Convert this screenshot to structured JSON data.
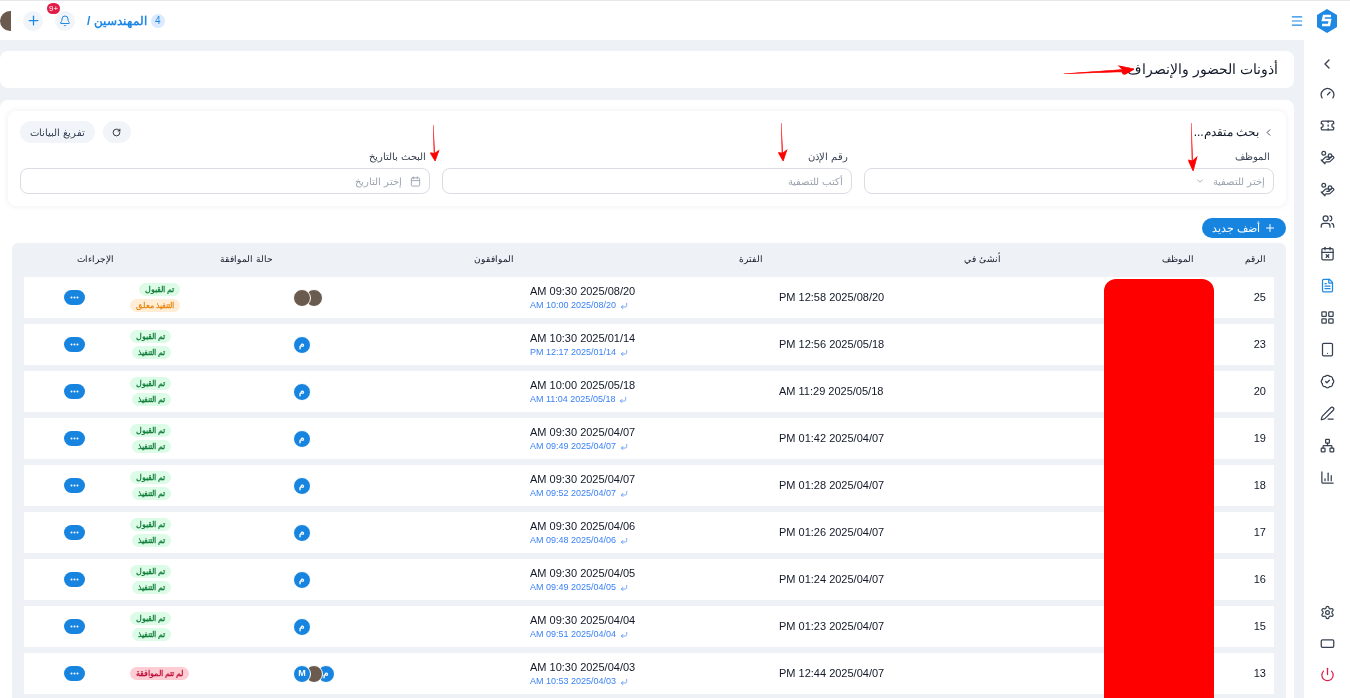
{
  "topbar": {
    "breadcrumb": "المهندسين /",
    "breadcrumb_count": "4",
    "notification_badge": "+9"
  },
  "sidebar": {
    "items": [
      {
        "selected": false
      },
      {
        "selected": false
      },
      {
        "selected": false
      },
      {
        "selected": false
      },
      {
        "selected": false
      },
      {
        "selected": false
      },
      {
        "selected": true
      },
      {
        "selected": false
      },
      {
        "selected": false
      },
      {
        "selected": false
      },
      {
        "selected": false
      },
      {
        "selected": false
      },
      {
        "selected": false
      }
    ],
    "bottom_items": [
      {
        "kind": "neutral"
      },
      {
        "kind": "neutral"
      },
      {
        "kind": "danger"
      }
    ]
  },
  "page_title": "أذونات الحضور والإنصراف",
  "filters": {
    "title": "بحث متقدم...",
    "clear_button": "تفريغ البيانات",
    "fields": [
      {
        "kind": "select",
        "label": "الموظف",
        "placeholder": "إختر للتصفية"
      },
      {
        "kind": "text",
        "label": "رقم الإذن",
        "placeholder": "أكتب للتصفية"
      },
      {
        "kind": "date",
        "label": "البحث بالتاريخ",
        "placeholder": "إختر التاريخ"
      }
    ]
  },
  "add_button": "أضف جديد",
  "table": {
    "columns": [
      "الرقم",
      "الموظف",
      "أنشئ في",
      "الفترة",
      "الموافقون",
      "حالة الموافقة",
      "الإجراءات"
    ],
    "rows": [
      {
        "number": "25",
        "created": "PM 12:58 2025/08/20",
        "period_start": "AM 09:30 2025/08/20",
        "period_end": "AM 10:00 2025/08/20",
        "approvers": [
          {
            "kind": "photo"
          },
          {
            "kind": "photo"
          }
        ],
        "statuses": [
          {
            "label": "تم القبول",
            "kind": "success"
          },
          {
            "label": "التنفيذ معلق",
            "kind": "warning"
          }
        ]
      },
      {
        "number": "23",
        "created": "PM 12:56 2025/05/18",
        "period_start": "AM 10:30 2025/01/14",
        "period_end": "PM 12:17 2025/01/14",
        "approvers": [
          {
            "kind": "initial",
            "initial": "م"
          }
        ],
        "statuses": [
          {
            "label": "تم القبول",
            "kind": "success"
          },
          {
            "label": "تم التنفيذ",
            "kind": "success"
          }
        ]
      },
      {
        "number": "20",
        "created": "AM 11:29 2025/05/18",
        "period_start": "AM 10:00 2025/05/18",
        "period_end": "AM 11:04 2025/05/18",
        "approvers": [
          {
            "kind": "initial",
            "initial": "م"
          }
        ],
        "statuses": [
          {
            "label": "تم القبول",
            "kind": "success"
          },
          {
            "label": "تم التنفيذ",
            "kind": "success"
          }
        ]
      },
      {
        "number": "19",
        "created": "PM 01:42 2025/04/07",
        "period_start": "AM 09:30 2025/04/07",
        "period_end": "AM 09:49 2025/04/07",
        "approvers": [
          {
            "kind": "initial",
            "initial": "م"
          }
        ],
        "statuses": [
          {
            "label": "تم القبول",
            "kind": "success"
          },
          {
            "label": "تم التنفيذ",
            "kind": "success"
          }
        ]
      },
      {
        "number": "18",
        "created": "PM 01:28 2025/04/07",
        "period_start": "AM 09:30 2025/04/07",
        "period_end": "AM 09:52 2025/04/07",
        "approvers": [
          {
            "kind": "initial",
            "initial": "م"
          }
        ],
        "statuses": [
          {
            "label": "تم القبول",
            "kind": "success"
          },
          {
            "label": "تم التنفيذ",
            "kind": "success"
          }
        ]
      },
      {
        "number": "17",
        "created": "PM 01:26 2025/04/07",
        "period_start": "AM 09:30 2025/04/06",
        "period_end": "AM 09:48 2025/04/06",
        "approvers": [
          {
            "kind": "initial",
            "initial": "م"
          }
        ],
        "statuses": [
          {
            "label": "تم القبول",
            "kind": "success"
          },
          {
            "label": "تم التنفيذ",
            "kind": "success"
          }
        ]
      },
      {
        "number": "16",
        "created": "PM 01:24 2025/04/07",
        "period_start": "AM 09:30 2025/04/05",
        "period_end": "AM 09:49 2025/04/05",
        "approvers": [
          {
            "kind": "initial",
            "initial": "م"
          }
        ],
        "statuses": [
          {
            "label": "تم القبول",
            "kind": "success"
          },
          {
            "label": "تم التنفيذ",
            "kind": "success"
          }
        ]
      },
      {
        "number": "15",
        "created": "PM 01:23 2025/04/07",
        "period_start": "AM 09:30 2025/04/04",
        "period_end": "AM 09:51 2025/04/04",
        "approvers": [
          {
            "kind": "initial",
            "initial": "م"
          }
        ],
        "statuses": [
          {
            "label": "تم القبول",
            "kind": "success"
          },
          {
            "label": "تم التنفيذ",
            "kind": "success"
          }
        ]
      },
      {
        "number": "13",
        "created": "PM 12:44 2025/04/07",
        "period_start": "AM 10:30 2025/04/03",
        "period_end": "AM 10:53 2025/04/03",
        "approvers": [
          {
            "kind": "initial",
            "initial": "م"
          },
          {
            "kind": "photo"
          },
          {
            "kind": "initial",
            "initial": "M"
          }
        ],
        "statuses": [
          {
            "label": "لم تتم الموافقة",
            "kind": "danger"
          }
        ]
      }
    ]
  }
}
